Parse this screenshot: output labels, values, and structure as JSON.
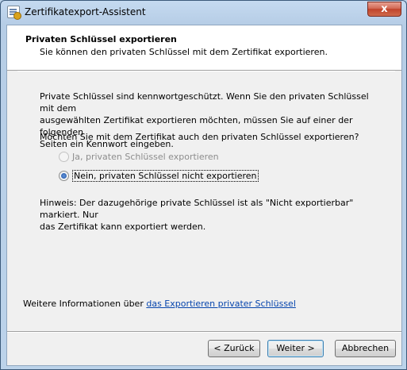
{
  "window": {
    "title": "Zertifikatexport-Assistent",
    "close_label": "x"
  },
  "header": {
    "title": "Privaten Schlüssel exportieren",
    "subtitle": "Sie können den privaten Schlüssel mit dem Zertifikat exportieren."
  },
  "body": {
    "info_line1": "Private Schlüssel sind kennwortgeschützt. Wenn Sie den privaten Schlüssel mit dem",
    "info_line2": "ausgewählten Zertifikat exportieren möchten, müssen Sie auf einer der folgenden",
    "info_line3": "Seiten ein Kennwort eingeben.",
    "question": "Möchten Sie mit dem Zertifikat auch den privaten Schlüssel exportieren?",
    "options": [
      {
        "label": "Ja, privaten Schlüssel exportieren",
        "checked": false,
        "enabled": false
      },
      {
        "label": "Nein, privaten Schlüssel nicht exportieren",
        "checked": true,
        "enabled": true
      }
    ],
    "hint_line1": "Hinweis: Der dazugehörige private Schlüssel ist als \"Nicht exportierbar\" markiert. Nur",
    "hint_line2": "das Zertifikat kann exportiert werden."
  },
  "more_info": {
    "prefix": "Weitere Informationen über",
    "link": "das Exportieren privater Schlüssel"
  },
  "buttons": {
    "back": "< Zurück",
    "next": "Weiter >",
    "cancel": "Abbrechen"
  }
}
